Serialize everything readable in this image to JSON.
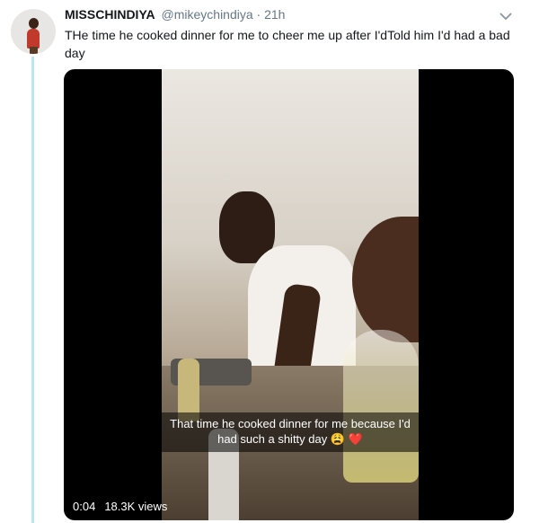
{
  "tweet": {
    "display_name": "MISSCHINDIYA",
    "handle": "@mikeychindiya",
    "separator": "·",
    "time": "21h",
    "text": "THe time he cooked dinner for me to cheer me up after I'dTold him I'd had a bad day"
  },
  "media": {
    "caption": "That time he cooked dinner for me because I'd had such a shitty day",
    "caption_emojis": [
      "😩",
      "❤️"
    ],
    "duration": "0:04",
    "views": "18.3K views"
  },
  "colors": {
    "thread_line": "#b7e6f7",
    "handle_gray": "#657786",
    "heart": "#e0245e"
  },
  "icons": [
    "chevron-down-icon",
    "avatar"
  ]
}
